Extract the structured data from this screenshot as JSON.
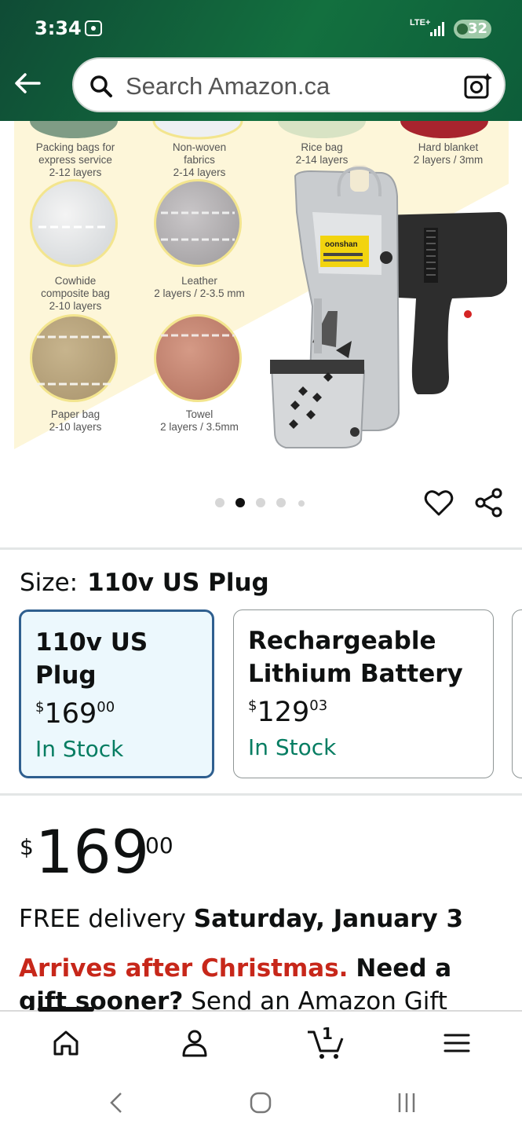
{
  "status_bar": {
    "time": "3:34",
    "network": "LTE+",
    "battery": "32"
  },
  "search": {
    "placeholder": "Search Amazon.ca"
  },
  "image_labels": [
    {
      "line1": "Packing bags for",
      "line2": "express service",
      "line3": "2-12 layers"
    },
    {
      "line1": "Non-woven",
      "line2": "fabrics",
      "line3": "2-14 layers"
    },
    {
      "line1": "Rice bag",
      "line2": "2-14 layers",
      "line3": ""
    },
    {
      "line1": "Hard blanket",
      "line2": "2 layers / 3mm",
      "line3": ""
    },
    {
      "line1": "Cowhide",
      "line2": "composite bag",
      "line3": "2-10 layers"
    },
    {
      "line1": "Leather",
      "line2": "2 layers / 2-3.5 mm",
      "line3": ""
    },
    {
      "line1": "Paper bag",
      "line2": "2-10 layers",
      "line3": ""
    },
    {
      "line1": "Towel",
      "line2": "2 layers / 3.5mm",
      "line3": ""
    }
  ],
  "machine_brand": "oonshan",
  "carousel": {
    "count": 5,
    "active": 1
  },
  "size": {
    "label": "Size:",
    "selected": "110v US Plug"
  },
  "options": [
    {
      "name_line1": "110v US Plug",
      "name_line2": "",
      "currency": "$",
      "whole": "169",
      "fraction": "00",
      "stock": "In Stock",
      "selected": true
    },
    {
      "name_line1": "Rechargeable",
      "name_line2": "Lithium Battery",
      "currency": "$",
      "whole": "129",
      "fraction": "03",
      "stock": "In Stock",
      "selected": false
    }
  ],
  "price": {
    "currency": "$",
    "whole": "169",
    "fraction": "00"
  },
  "delivery": {
    "prefix": "FREE delivery",
    "date": "Saturday, January 3"
  },
  "promo": {
    "red": "Arrives after Christmas.",
    "bold": "Need a gift sooner?",
    "rest": "Send an Amazon Gift Card"
  },
  "bottom_nav": {
    "cart_count": "1",
    "items": [
      "home-icon",
      "account-icon",
      "cart-icon",
      "menu-icon"
    ]
  },
  "colors": {
    "header": "#13703f",
    "selected_border": "#2f5f8f",
    "stock_green": "#067d62",
    "promo_red": "#c7271a"
  }
}
